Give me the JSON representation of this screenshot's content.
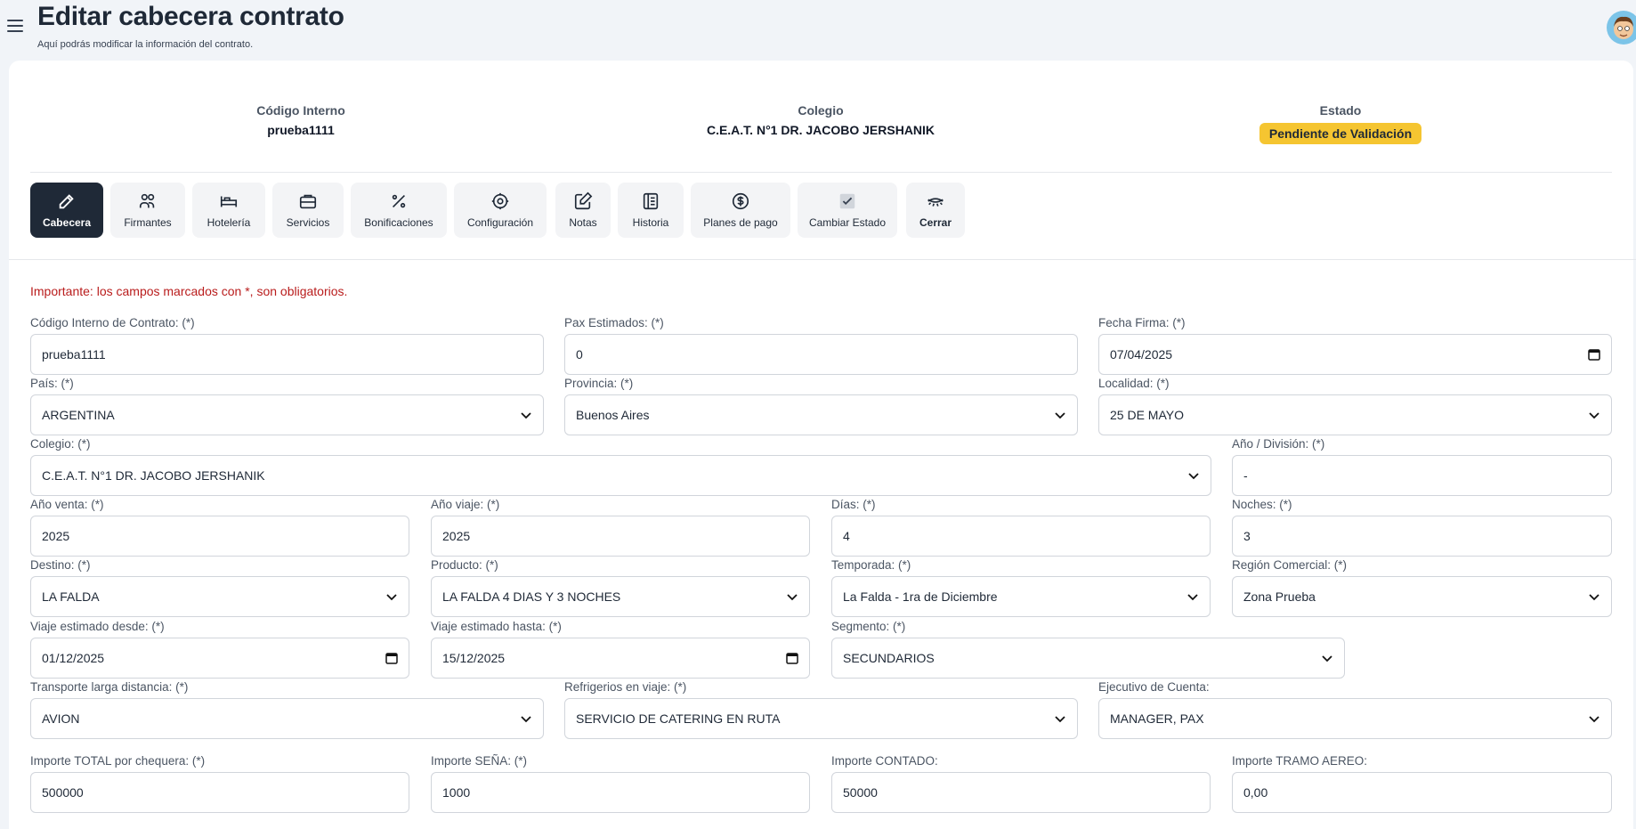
{
  "header": {
    "title": "Editar cabecera contrato",
    "subtitle": "Aquí podrás modificar la información del contrato."
  },
  "info": {
    "codigo_label": "Código Interno",
    "codigo_value": "prueba1111",
    "colegio_label": "Colegio",
    "colegio_value": "C.E.A.T. N°1 DR. JACOBO JERSHANIK",
    "estado_label": "Estado",
    "estado_value": "Pendiente de Validación"
  },
  "tabs": [
    {
      "label": "Cabecera",
      "icon": "pencil-icon",
      "active": true
    },
    {
      "label": "Firmantes",
      "icon": "users-icon"
    },
    {
      "label": "Hotelería",
      "icon": "bed-icon"
    },
    {
      "label": "Servicios",
      "icon": "briefcase-icon"
    },
    {
      "label": "Bonificaciones",
      "icon": "percent-icon"
    },
    {
      "label": "Configuración",
      "icon": "gear-icon"
    },
    {
      "label": "Notas",
      "icon": "edit-icon"
    },
    {
      "label": "Historia",
      "icon": "history-icon"
    },
    {
      "label": "Planes de pago",
      "icon": "dollar-icon"
    },
    {
      "label": "Cambiar Estado",
      "icon": "check-icon"
    },
    {
      "label": "Cerrar",
      "icon": "eye-closed-icon"
    }
  ],
  "important": "Importante: los campos marcados con *, son obligatorios.",
  "form": {
    "codigo": {
      "label": "Código Interno de Contrato: (*)",
      "value": "prueba1111"
    },
    "pax": {
      "label": "Pax Estimados: (*)",
      "value": "0"
    },
    "fecha_firma": {
      "label": "Fecha Firma: (*)",
      "value": "07/04/2025"
    },
    "pais": {
      "label": "País: (*)",
      "value": "ARGENTINA"
    },
    "provincia": {
      "label": "Provincia: (*)",
      "value": "Buenos Aires"
    },
    "localidad": {
      "label": "Localidad: (*)",
      "value": "25 DE MAYO"
    },
    "colegio": {
      "label": "Colegio: (*)",
      "value": "C.E.A.T. N°1 DR. JACOBO JERSHANIK"
    },
    "division": {
      "label": "Año / División: (*)",
      "value": "-"
    },
    "anio_venta": {
      "label": "Año venta: (*)",
      "value": "2025"
    },
    "anio_viaje": {
      "label": "Año viaje: (*)",
      "value": "2025"
    },
    "dias": {
      "label": "Días: (*)",
      "value": "4"
    },
    "noches": {
      "label": "Noches: (*)",
      "value": "3"
    },
    "destino": {
      "label": "Destino: (*)",
      "value": "LA FALDA"
    },
    "producto": {
      "label": "Producto: (*)",
      "value": "LA FALDA 4 DIAS Y 3 NOCHES"
    },
    "temporada": {
      "label": "Temporada: (*)",
      "value": "La Falda - 1ra de Diciembre"
    },
    "region": {
      "label": "Región Comercial: (*)",
      "value": "Zona Prueba"
    },
    "viaje_desde": {
      "label": "Viaje estimado desde: (*)",
      "value": "01/12/2025"
    },
    "viaje_hasta": {
      "label": "Viaje estimado hasta: (*)",
      "value": "15/12/2025"
    },
    "segmento": {
      "label": "Segmento: (*)",
      "value": "SECUNDARIOS"
    },
    "transporte": {
      "label": "Transporte larga distancia: (*)",
      "value": "AVION"
    },
    "refrigerios": {
      "label": "Refrigerios en viaje: (*)",
      "value": "SERVICIO DE CATERING EN RUTA"
    },
    "ejecutivo": {
      "label": "Ejecutivo de Cuenta:",
      "value": "MANAGER, PAX"
    },
    "importe_total": {
      "label": "Importe TOTAL por chequera: (*)",
      "value": "500000"
    },
    "importe_sena": {
      "label": "Importe SEÑA: (*)",
      "value": "1000"
    },
    "importe_contado": {
      "label": "Importe CONTADO:",
      "value": "50000"
    },
    "importe_tramo": {
      "label": "Importe TRAMO AEREO:",
      "value": "0,00"
    }
  }
}
